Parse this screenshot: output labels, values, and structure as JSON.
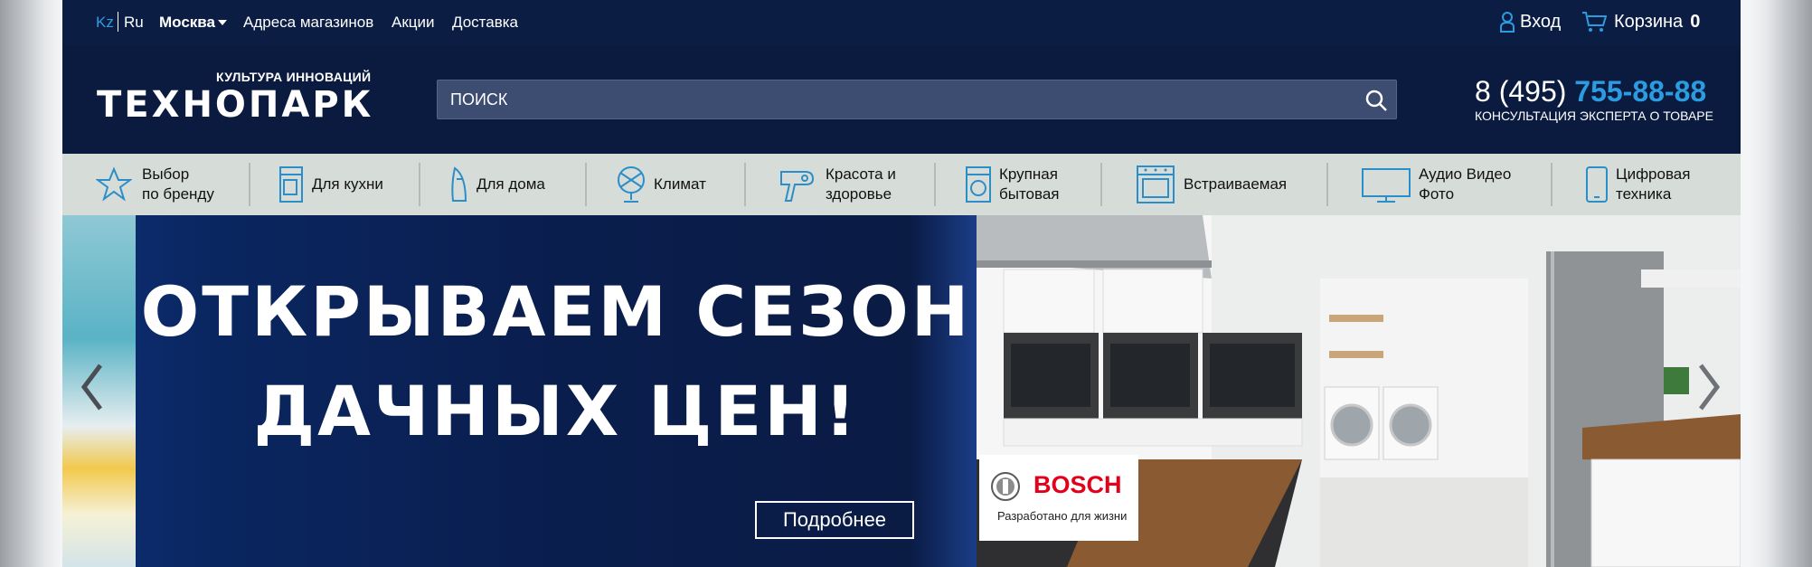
{
  "topbar": {
    "lang_kz": "Kz",
    "lang_ru": "Ru",
    "city": "Москва",
    "links": [
      "Адреса магазинов",
      "Акции",
      "Доставка"
    ],
    "login": "Вход",
    "cart_label": "Корзина",
    "cart_count": "0"
  },
  "header": {
    "tagline": "КУЛЬТУРА ИННОВАЦИЙ",
    "logo_text": "ТЕХНОПАРК",
    "search_placeholder": "ПОИСК",
    "phone_prefix": "8 (495)",
    "phone_number": "755-88-88",
    "phone_caption": "КОНСУЛЬТАЦИЯ ЭКСПЕРТА О ТОВАРЕ"
  },
  "categories": [
    {
      "label": "Выбор\nпо бренду",
      "icon": "star-icon"
    },
    {
      "label": "Для кухни",
      "icon": "coffee-maker-icon"
    },
    {
      "label": "Для дома",
      "icon": "iron-icon"
    },
    {
      "label": "Климат",
      "icon": "fan-icon"
    },
    {
      "label": "Красота и\nздоровье",
      "icon": "hair-dryer-icon"
    },
    {
      "label": "Крупная\nбытовая",
      "icon": "washing-machine-icon"
    },
    {
      "label": "Встраиваемая",
      "icon": "built-in-oven-icon"
    },
    {
      "label": "Аудио Видео\nФото",
      "icon": "tv-icon"
    },
    {
      "label": "Цифровая\nтехника",
      "icon": "smartphone-icon"
    }
  ],
  "banner": {
    "headline_line1": "ОТКРЫВАЕМ СЕЗОН",
    "headline_line2": "ДАЧНЫХ ЦЕН!",
    "cta": "Подробнее",
    "brand_name": "BOSCH",
    "brand_slogan": "Разработано для жизни"
  },
  "colors": {
    "accent": "#2c9ce0",
    "topbar_bg": "#0c1d44",
    "nav_bg": "#d6dcd8",
    "brand_red": "#e2001a"
  }
}
